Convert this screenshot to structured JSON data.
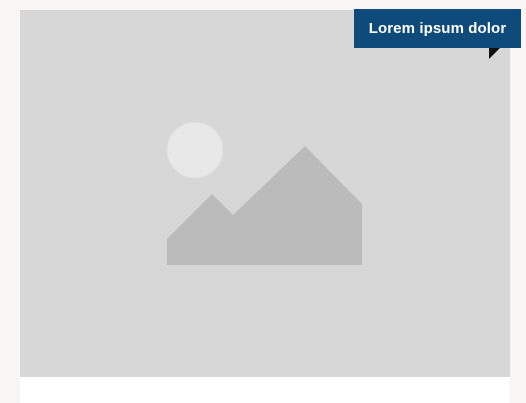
{
  "card": {
    "ribbon_label": "Lorem ipsum dolor"
  },
  "image_placeholder": {
    "icon": "image-placeholder-icon",
    "background_color": "#d7d7d7",
    "sun_color": "#e8e8e8",
    "mountain_color": "#bbbbbb"
  },
  "colors": {
    "ribbon_background": "#0e4b7a",
    "ribbon_fold": "#111111",
    "ribbon_text": "#ffffff",
    "page_background": "#f7f6f4",
    "card_background": "#ffffff"
  }
}
